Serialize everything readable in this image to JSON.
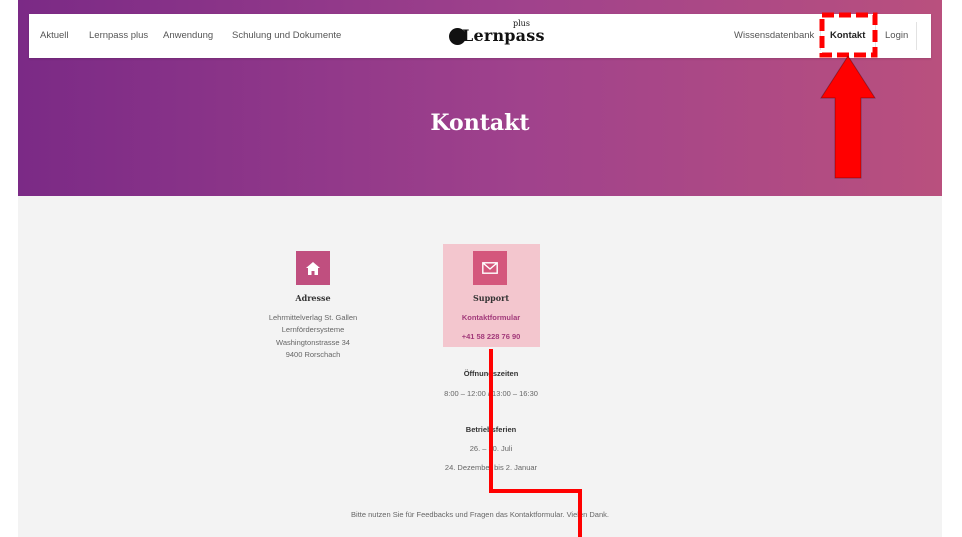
{
  "nav": {
    "left_items": [
      "Aktuell",
      "Lernpass plus",
      "Anwendung",
      "Schulung und Dokumente"
    ],
    "logo_text": "Lernpass",
    "logo_superscript": "plus",
    "right_items": [
      "Wissensdatenbank",
      "Kontakt",
      "Login"
    ],
    "active_item": "Kontakt"
  },
  "hero": {
    "title": "Kontakt"
  },
  "address": {
    "icon": "home-icon",
    "title": "Adresse",
    "lines": [
      "Lehrmittelverlag St. Gallen",
      "Lernfördersysteme",
      "Washingtonstrasse 34",
      "9400 Rorschach"
    ]
  },
  "support": {
    "icon": "envelope-icon",
    "title": "Support",
    "link_label": "Kontaktformular",
    "phone": "+41 58 228 76 90",
    "highlight_color": "#f3c6ce"
  },
  "hours": {
    "title": "Öffnungszeiten",
    "text": "8:00 – 12:00 / 13:00 – 16:30"
  },
  "holidays": {
    "title": "Betriebsferien",
    "lines": [
      "26. – 30. Juli",
      "24. Dezember bis 2. Januar"
    ]
  },
  "footer_note": "Bitte nutzen Sie für Feedbacks und Fragen das Kontaktformular. Vielen Dank.",
  "colors": {
    "hero_gradient": [
      "#7b2a86",
      "#b9507e"
    ],
    "accent": "#c04f7f",
    "annotation": "#ff0000"
  }
}
